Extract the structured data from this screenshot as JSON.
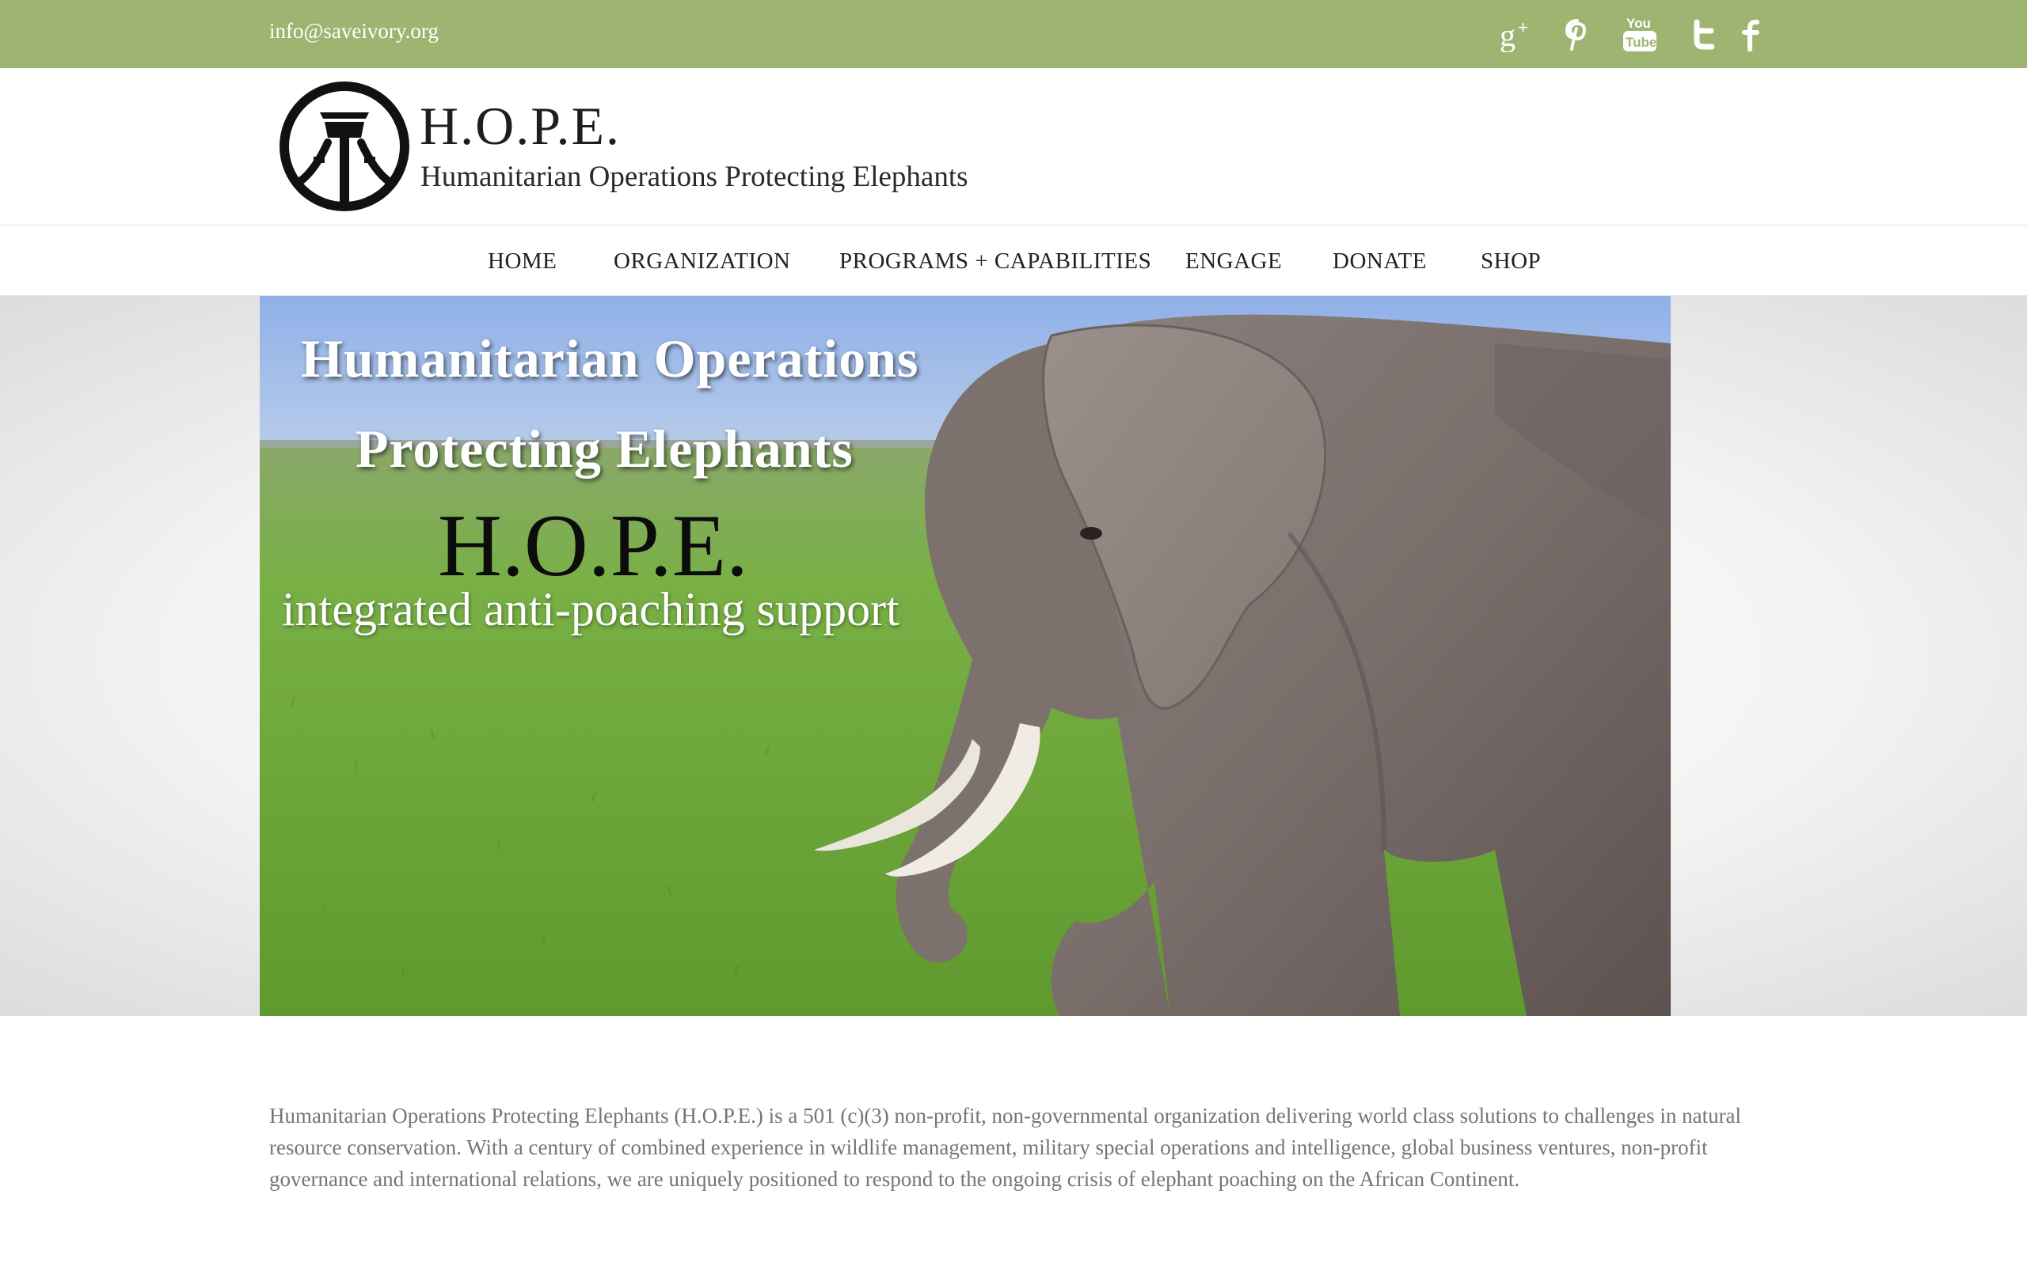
{
  "topbar": {
    "email": "info@saveivory.org",
    "social": [
      "google-plus-icon",
      "pinterest-icon",
      "youtube-icon",
      "twitter-icon",
      "facebook-icon"
    ],
    "youtube_text": [
      "You",
      "Tube"
    ]
  },
  "header": {
    "title": "H.O.P.E.",
    "subtitle": "Humanitarian Operations Protecting Elephants"
  },
  "nav": {
    "items": [
      "HOME",
      "ORGANIZATION",
      "PROGRAMS + CAPABILITIES",
      "ENGAGE",
      "DONATE",
      "SHOP"
    ]
  },
  "hero": {
    "line1": "Humanitarian Operations",
    "line2": "Protecting Elephants",
    "acronym": "H.O.P.E.",
    "tagline": "integrated anti-poaching support"
  },
  "intro": {
    "text": "Humanitarian Operations Protecting Elephants (H.O.P.E.) is a 501 (c)(3) non-profit, non-governmental organization delivering world class solutions to challenges in natural resource conservation. With a century of combined experience in wildlife management, military special operations and intelligence, global business ventures, non-profit governance and international relations, we are uniquely positioned to respond to the ongoing crisis of elephant poaching on the African Continent."
  },
  "colors": {
    "topbar": "#9db571",
    "body_text": "#757575",
    "nav_text": "#222222"
  }
}
